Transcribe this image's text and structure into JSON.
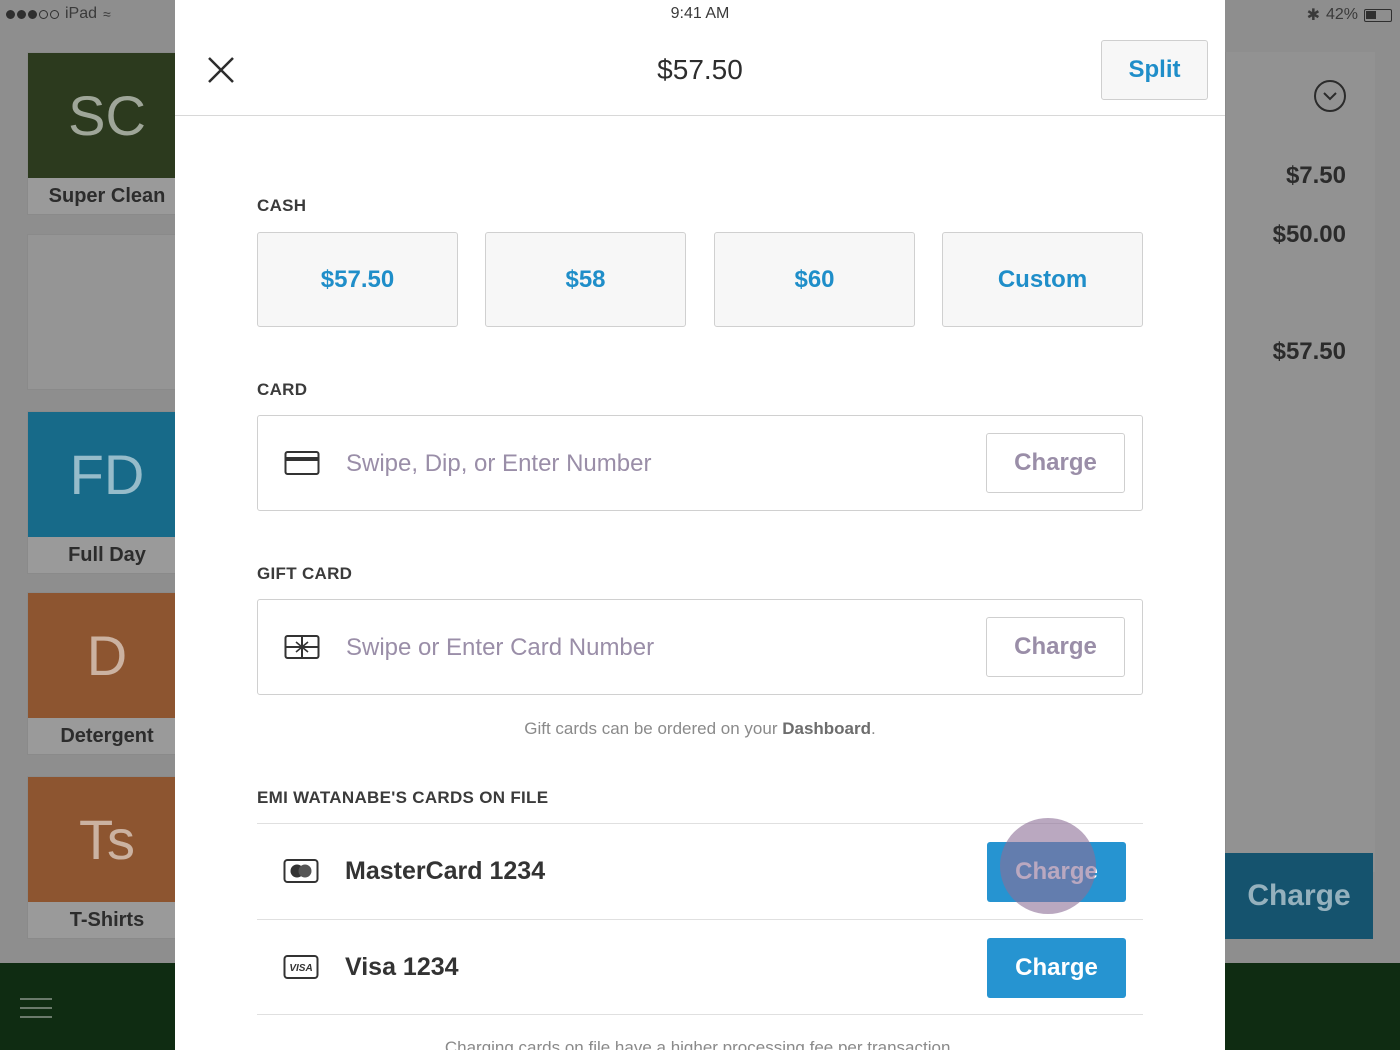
{
  "status_bar": {
    "carrier": "iPad",
    "time": "9:41 AM",
    "battery": "42%"
  },
  "background": {
    "tiles": [
      {
        "initials": "SC",
        "name": "Super Clean",
        "color": "#2c3a1e"
      },
      {
        "initials": "",
        "name": "",
        "color": "#959595"
      },
      {
        "initials": "FD",
        "name": "Full Day",
        "color": "#176a89"
      },
      {
        "initials": "D",
        "name": "Detergent",
        "color": "#8d5530"
      },
      {
        "initials": "Ts",
        "name": "T-Shirts",
        "color": "#8d5530"
      }
    ],
    "amounts": [
      "$7.50",
      "$50.00",
      "$57.50"
    ],
    "charge_label": "Charge"
  },
  "modal": {
    "title": "$57.50",
    "split_label": "Split",
    "cash": {
      "label": "CASH",
      "options": [
        "$57.50",
        "$58",
        "$60",
        "Custom"
      ]
    },
    "card": {
      "label": "CARD",
      "placeholder": "Swipe, Dip, or Enter Number",
      "charge_label": "Charge"
    },
    "gift_card": {
      "label": "GIFT CARD",
      "placeholder": "Swipe or Enter Card Number",
      "charge_label": "Charge",
      "helper_text": "Gift cards can be ordered on your ",
      "helper_link": "Dashboard",
      "helper_end": "."
    },
    "cards_on_file": {
      "label": "EMI WATANABE'S CARDS ON FILE",
      "cards": [
        {
          "name": "MasterCard 1234",
          "icon": "mastercard-icon",
          "charge_label": "Charge"
        },
        {
          "name": "Visa 1234",
          "icon": "visa-icon",
          "charge_label": "Charge"
        }
      ],
      "footer_note": "Charging cards on file have a higher processing fee per transaction."
    }
  },
  "colors": {
    "accent": "#2694d1",
    "placeholder": "#9a8ea8"
  }
}
